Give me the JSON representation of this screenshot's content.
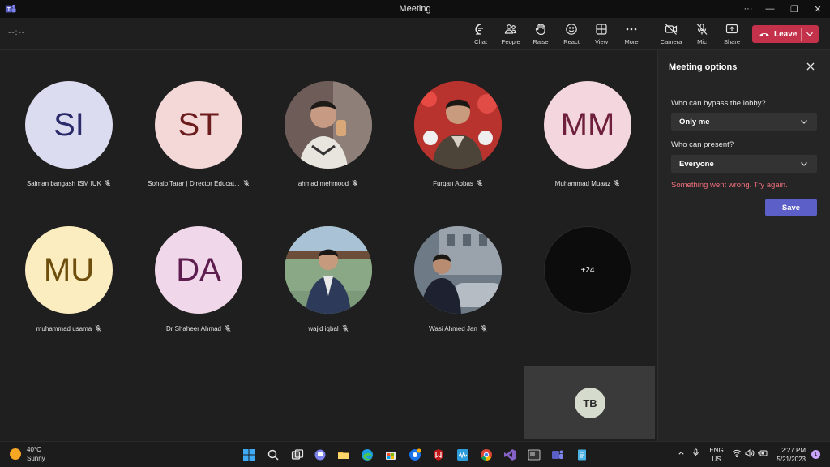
{
  "window": {
    "title": "Meeting"
  },
  "meeting_timer": "--:--",
  "toolbar": {
    "chat": "Chat",
    "people": "People",
    "raise": "Raise",
    "react": "React",
    "view": "View",
    "more": "More",
    "camera": "Camera",
    "mic": "Mic",
    "share": "Share",
    "leave": "Leave"
  },
  "participants": [
    {
      "name": "Salman bangash ISM IUK",
      "initials": "SI",
      "bg": "#dcdcf0",
      "fg": "#2b2a6b",
      "photo": false
    },
    {
      "name": "Sohaib Tarar | Director Educat...",
      "initials": "ST",
      "bg": "#f4d8d8",
      "fg": "#6b1d1d",
      "photo": false
    },
    {
      "name": "ahmad mehmood",
      "initials": "",
      "bg": "#6d5c58",
      "fg": "#fff",
      "photo": true
    },
    {
      "name": "Furqan Abbas",
      "initials": "",
      "bg": "#b8322e",
      "fg": "#fff",
      "photo": true
    },
    {
      "name": "Muhammad Muaaz",
      "initials": "MM",
      "bg": "#f4d6df",
      "fg": "#6e1f3b",
      "photo": false
    },
    {
      "name": "muhammad usama",
      "initials": "MU",
      "bg": "#fcedc0",
      "fg": "#6e4e0c",
      "photo": false
    },
    {
      "name": "Dr Shaheer Ahmad",
      "initials": "DA",
      "bg": "#f1d7ea",
      "fg": "#5d1d4e",
      "photo": false
    },
    {
      "name": "wajid iqbal",
      "initials": "",
      "bg": "#7c9a7a",
      "fg": "#fff",
      "photo": true
    },
    {
      "name": "Wasi Ahmed Jan",
      "initials": "",
      "bg": "#6e7a86",
      "fg": "#fff",
      "photo": true
    },
    {
      "name": "",
      "initials": "+24",
      "bg": "#0c0c0c",
      "fg": "#ffffff",
      "photo": false
    }
  ],
  "self_view": {
    "initials": "TB"
  },
  "options_panel": {
    "title": "Meeting options",
    "bypass_label": "Who can bypass the lobby?",
    "bypass_value": "Only me",
    "present_label": "Who can present?",
    "present_value": "Everyone",
    "error": "Something went wrong. Try again.",
    "save": "Save"
  },
  "taskbar": {
    "weather_temp": "40°C",
    "weather_desc": "Sunny",
    "lang_top": "ENG",
    "lang_bottom": "US",
    "time": "2:27 PM",
    "date": "5/21/2023",
    "notif_count": "1"
  }
}
